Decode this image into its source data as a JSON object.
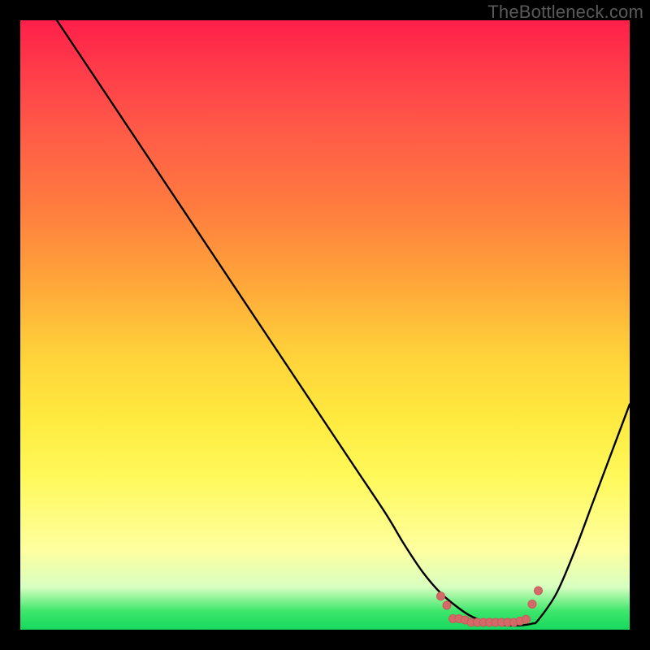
{
  "watermark": "TheBottleneck.com",
  "colors": {
    "curve": "#000000",
    "marker_fill": "#d46a68",
    "marker_stroke": "#c65a58"
  },
  "chart_data": {
    "type": "line",
    "title": "",
    "xlabel": "",
    "ylabel": "",
    "xlim": [
      0,
      100
    ],
    "ylim": [
      0,
      100
    ],
    "series": [
      {
        "name": "bottleneck-curve",
        "x": [
          6,
          10,
          15,
          20,
          25,
          30,
          35,
          40,
          45,
          50,
          55,
          60,
          63,
          66,
          69,
          72,
          74,
          76,
          78,
          80,
          82,
          84,
          85,
          88,
          91,
          94,
          97,
          100
        ],
        "y": [
          100,
          94,
          86.5,
          79,
          71.5,
          64,
          56.5,
          49,
          41.5,
          34,
          26.5,
          19,
          14,
          9.5,
          6,
          3.5,
          2.2,
          1.4,
          0.9,
          0.7,
          0.7,
          1.0,
          1.6,
          6,
          13,
          21,
          29,
          37
        ]
      }
    ],
    "markers": {
      "name": "bottom-cluster",
      "points": [
        {
          "x": 69,
          "y": 5.5
        },
        {
          "x": 70,
          "y": 4.0
        },
        {
          "x": 71,
          "y": 1.8
        },
        {
          "x": 72,
          "y": 1.8
        },
        {
          "x": 73,
          "y": 1.6
        },
        {
          "x": 74,
          "y": 1.2
        },
        {
          "x": 75,
          "y": 1.2
        },
        {
          "x": 76,
          "y": 1.2
        },
        {
          "x": 77,
          "y": 1.2
        },
        {
          "x": 78,
          "y": 1.2
        },
        {
          "x": 79,
          "y": 1.2
        },
        {
          "x": 80,
          "y": 1.2
        },
        {
          "x": 81,
          "y": 1.2
        },
        {
          "x": 82,
          "y": 1.4
        },
        {
          "x": 83,
          "y": 1.7
        },
        {
          "x": 84,
          "y": 4.2
        },
        {
          "x": 85,
          "y": 6.4
        }
      ]
    }
  }
}
